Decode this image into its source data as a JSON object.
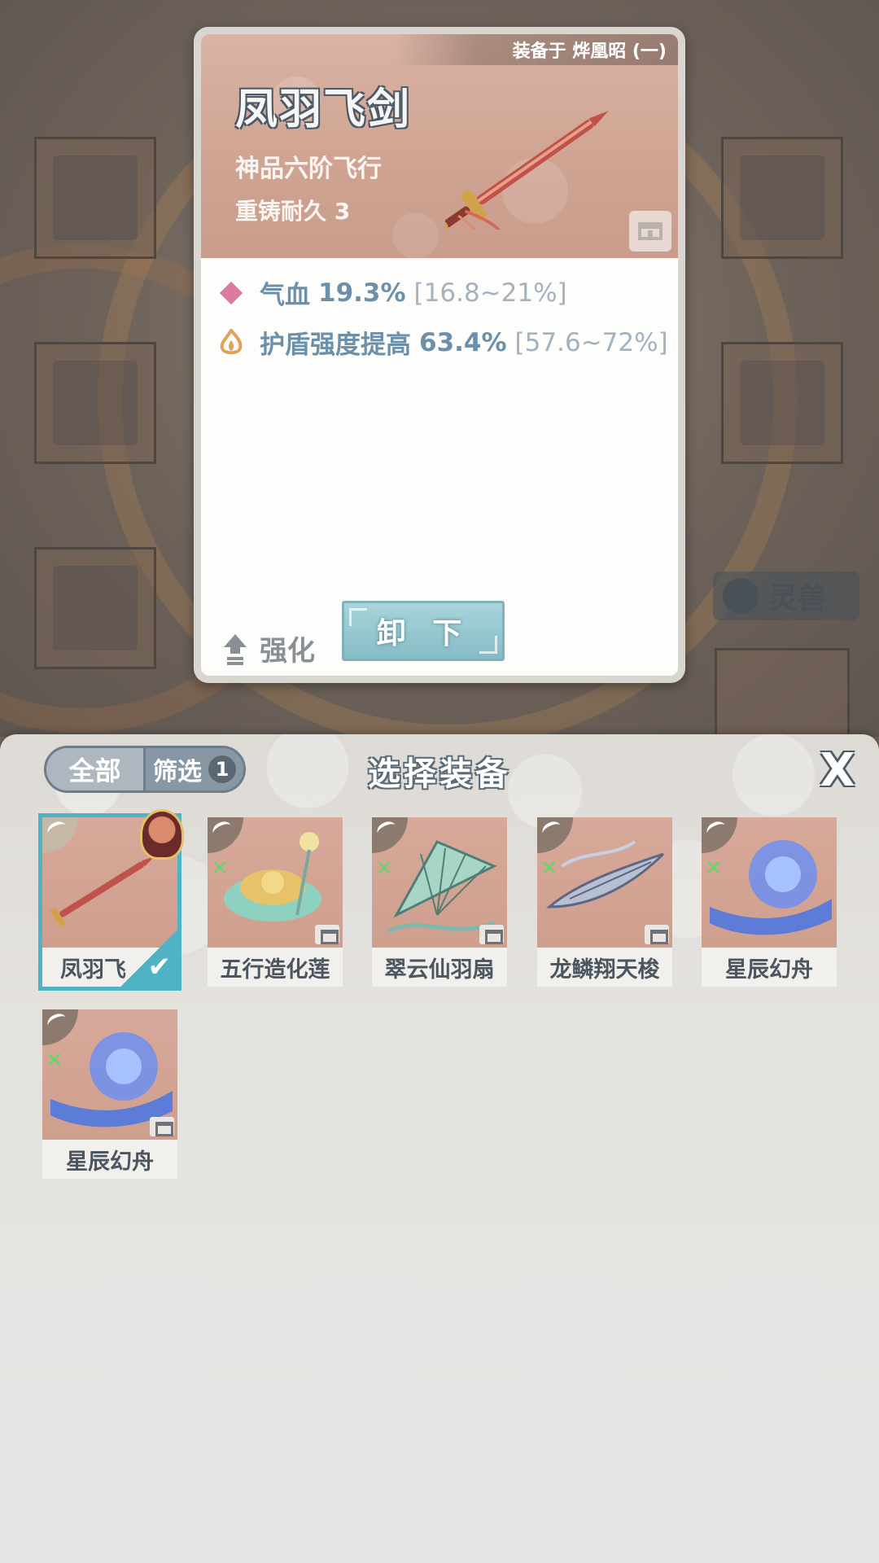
{
  "detail": {
    "equipped_on": "装备于 烨凰昭 (一)",
    "name": "凤羽飞剑",
    "grade": "神品六阶飞行",
    "durability": "重铸耐久 3",
    "stats": [
      {
        "label": "气血",
        "value": "19.3%",
        "range": "[16.8~21%]",
        "icon": "diamond-icon",
        "color": "#dd7aa0"
      },
      {
        "label": "护盾强度提高",
        "value": "63.4%",
        "range": "[57.6~72%]",
        "icon": "flame-icon",
        "color": "#e0a15a"
      }
    ],
    "enhance_label": "强化",
    "unequip_label": "卸 下"
  },
  "background": {
    "pet_tab_label": "灵兽"
  },
  "panel": {
    "tab_all": "全部",
    "tab_filter": "筛选",
    "filter_count": "1",
    "title": "选择装备",
    "close_label": "X"
  },
  "items": [
    {
      "name": "凤羽飞剑",
      "display": "凤羽飞",
      "selected": true
    },
    {
      "name": "五行造化莲",
      "display": "五行造化莲",
      "selected": false
    },
    {
      "name": "翠云仙羽扇",
      "display": "翠云仙羽扇",
      "selected": false
    },
    {
      "name": "龙鳞翔天梭",
      "display": "龙鳞翔天梭",
      "selected": false
    },
    {
      "name": "星辰幻舟",
      "display": "星辰幻舟",
      "selected": false
    },
    {
      "name": "星辰幻舟",
      "display": "星辰幻舟",
      "selected": false
    }
  ]
}
